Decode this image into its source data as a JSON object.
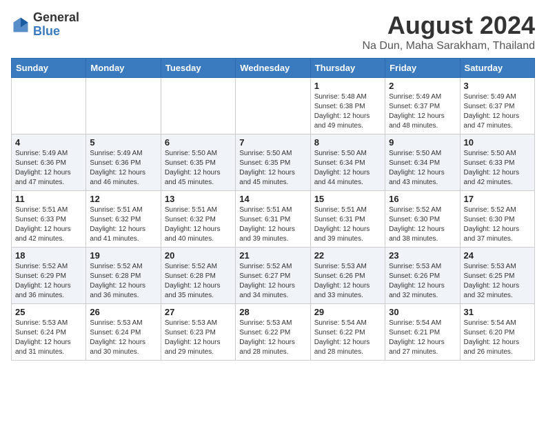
{
  "logo": {
    "general": "General",
    "blue": "Blue"
  },
  "header": {
    "month": "August 2024",
    "location": "Na Dun, Maha Sarakham, Thailand"
  },
  "weekdays": [
    "Sunday",
    "Monday",
    "Tuesday",
    "Wednesday",
    "Thursday",
    "Friday",
    "Saturday"
  ],
  "weeks": [
    [
      {
        "day": "",
        "sunrise": "",
        "sunset": "",
        "daylight": ""
      },
      {
        "day": "",
        "sunrise": "",
        "sunset": "",
        "daylight": ""
      },
      {
        "day": "",
        "sunrise": "",
        "sunset": "",
        "daylight": ""
      },
      {
        "day": "",
        "sunrise": "",
        "sunset": "",
        "daylight": ""
      },
      {
        "day": "1",
        "sunrise": "Sunrise: 5:48 AM",
        "sunset": "Sunset: 6:38 PM",
        "daylight": "Daylight: 12 hours and 49 minutes."
      },
      {
        "day": "2",
        "sunrise": "Sunrise: 5:49 AM",
        "sunset": "Sunset: 6:37 PM",
        "daylight": "Daylight: 12 hours and 48 minutes."
      },
      {
        "day": "3",
        "sunrise": "Sunrise: 5:49 AM",
        "sunset": "Sunset: 6:37 PM",
        "daylight": "Daylight: 12 hours and 47 minutes."
      }
    ],
    [
      {
        "day": "4",
        "sunrise": "Sunrise: 5:49 AM",
        "sunset": "Sunset: 6:36 PM",
        "daylight": "Daylight: 12 hours and 47 minutes."
      },
      {
        "day": "5",
        "sunrise": "Sunrise: 5:49 AM",
        "sunset": "Sunset: 6:36 PM",
        "daylight": "Daylight: 12 hours and 46 minutes."
      },
      {
        "day": "6",
        "sunrise": "Sunrise: 5:50 AM",
        "sunset": "Sunset: 6:35 PM",
        "daylight": "Daylight: 12 hours and 45 minutes."
      },
      {
        "day": "7",
        "sunrise": "Sunrise: 5:50 AM",
        "sunset": "Sunset: 6:35 PM",
        "daylight": "Daylight: 12 hours and 45 minutes."
      },
      {
        "day": "8",
        "sunrise": "Sunrise: 5:50 AM",
        "sunset": "Sunset: 6:34 PM",
        "daylight": "Daylight: 12 hours and 44 minutes."
      },
      {
        "day": "9",
        "sunrise": "Sunrise: 5:50 AM",
        "sunset": "Sunset: 6:34 PM",
        "daylight": "Daylight: 12 hours and 43 minutes."
      },
      {
        "day": "10",
        "sunrise": "Sunrise: 5:50 AM",
        "sunset": "Sunset: 6:33 PM",
        "daylight": "Daylight: 12 hours and 42 minutes."
      }
    ],
    [
      {
        "day": "11",
        "sunrise": "Sunrise: 5:51 AM",
        "sunset": "Sunset: 6:33 PM",
        "daylight": "Daylight: 12 hours and 42 minutes."
      },
      {
        "day": "12",
        "sunrise": "Sunrise: 5:51 AM",
        "sunset": "Sunset: 6:32 PM",
        "daylight": "Daylight: 12 hours and 41 minutes."
      },
      {
        "day": "13",
        "sunrise": "Sunrise: 5:51 AM",
        "sunset": "Sunset: 6:32 PM",
        "daylight": "Daylight: 12 hours and 40 minutes."
      },
      {
        "day": "14",
        "sunrise": "Sunrise: 5:51 AM",
        "sunset": "Sunset: 6:31 PM",
        "daylight": "Daylight: 12 hours and 39 minutes."
      },
      {
        "day": "15",
        "sunrise": "Sunrise: 5:51 AM",
        "sunset": "Sunset: 6:31 PM",
        "daylight": "Daylight: 12 hours and 39 minutes."
      },
      {
        "day": "16",
        "sunrise": "Sunrise: 5:52 AM",
        "sunset": "Sunset: 6:30 PM",
        "daylight": "Daylight: 12 hours and 38 minutes."
      },
      {
        "day": "17",
        "sunrise": "Sunrise: 5:52 AM",
        "sunset": "Sunset: 6:30 PM",
        "daylight": "Daylight: 12 hours and 37 minutes."
      }
    ],
    [
      {
        "day": "18",
        "sunrise": "Sunrise: 5:52 AM",
        "sunset": "Sunset: 6:29 PM",
        "daylight": "Daylight: 12 hours and 36 minutes."
      },
      {
        "day": "19",
        "sunrise": "Sunrise: 5:52 AM",
        "sunset": "Sunset: 6:28 PM",
        "daylight": "Daylight: 12 hours and 36 minutes."
      },
      {
        "day": "20",
        "sunrise": "Sunrise: 5:52 AM",
        "sunset": "Sunset: 6:28 PM",
        "daylight": "Daylight: 12 hours and 35 minutes."
      },
      {
        "day": "21",
        "sunrise": "Sunrise: 5:52 AM",
        "sunset": "Sunset: 6:27 PM",
        "daylight": "Daylight: 12 hours and 34 minutes."
      },
      {
        "day": "22",
        "sunrise": "Sunrise: 5:53 AM",
        "sunset": "Sunset: 6:26 PM",
        "daylight": "Daylight: 12 hours and 33 minutes."
      },
      {
        "day": "23",
        "sunrise": "Sunrise: 5:53 AM",
        "sunset": "Sunset: 6:26 PM",
        "daylight": "Daylight: 12 hours and 32 minutes."
      },
      {
        "day": "24",
        "sunrise": "Sunrise: 5:53 AM",
        "sunset": "Sunset: 6:25 PM",
        "daylight": "Daylight: 12 hours and 32 minutes."
      }
    ],
    [
      {
        "day": "25",
        "sunrise": "Sunrise: 5:53 AM",
        "sunset": "Sunset: 6:24 PM",
        "daylight": "Daylight: 12 hours and 31 minutes."
      },
      {
        "day": "26",
        "sunrise": "Sunrise: 5:53 AM",
        "sunset": "Sunset: 6:24 PM",
        "daylight": "Daylight: 12 hours and 30 minutes."
      },
      {
        "day": "27",
        "sunrise": "Sunrise: 5:53 AM",
        "sunset": "Sunset: 6:23 PM",
        "daylight": "Daylight: 12 hours and 29 minutes."
      },
      {
        "day": "28",
        "sunrise": "Sunrise: 5:53 AM",
        "sunset": "Sunset: 6:22 PM",
        "daylight": "Daylight: 12 hours and 28 minutes."
      },
      {
        "day": "29",
        "sunrise": "Sunrise: 5:54 AM",
        "sunset": "Sunset: 6:22 PM",
        "daylight": "Daylight: 12 hours and 28 minutes."
      },
      {
        "day": "30",
        "sunrise": "Sunrise: 5:54 AM",
        "sunset": "Sunset: 6:21 PM",
        "daylight": "Daylight: 12 hours and 27 minutes."
      },
      {
        "day": "31",
        "sunrise": "Sunrise: 5:54 AM",
        "sunset": "Sunset: 6:20 PM",
        "daylight": "Daylight: 12 hours and 26 minutes."
      }
    ]
  ]
}
